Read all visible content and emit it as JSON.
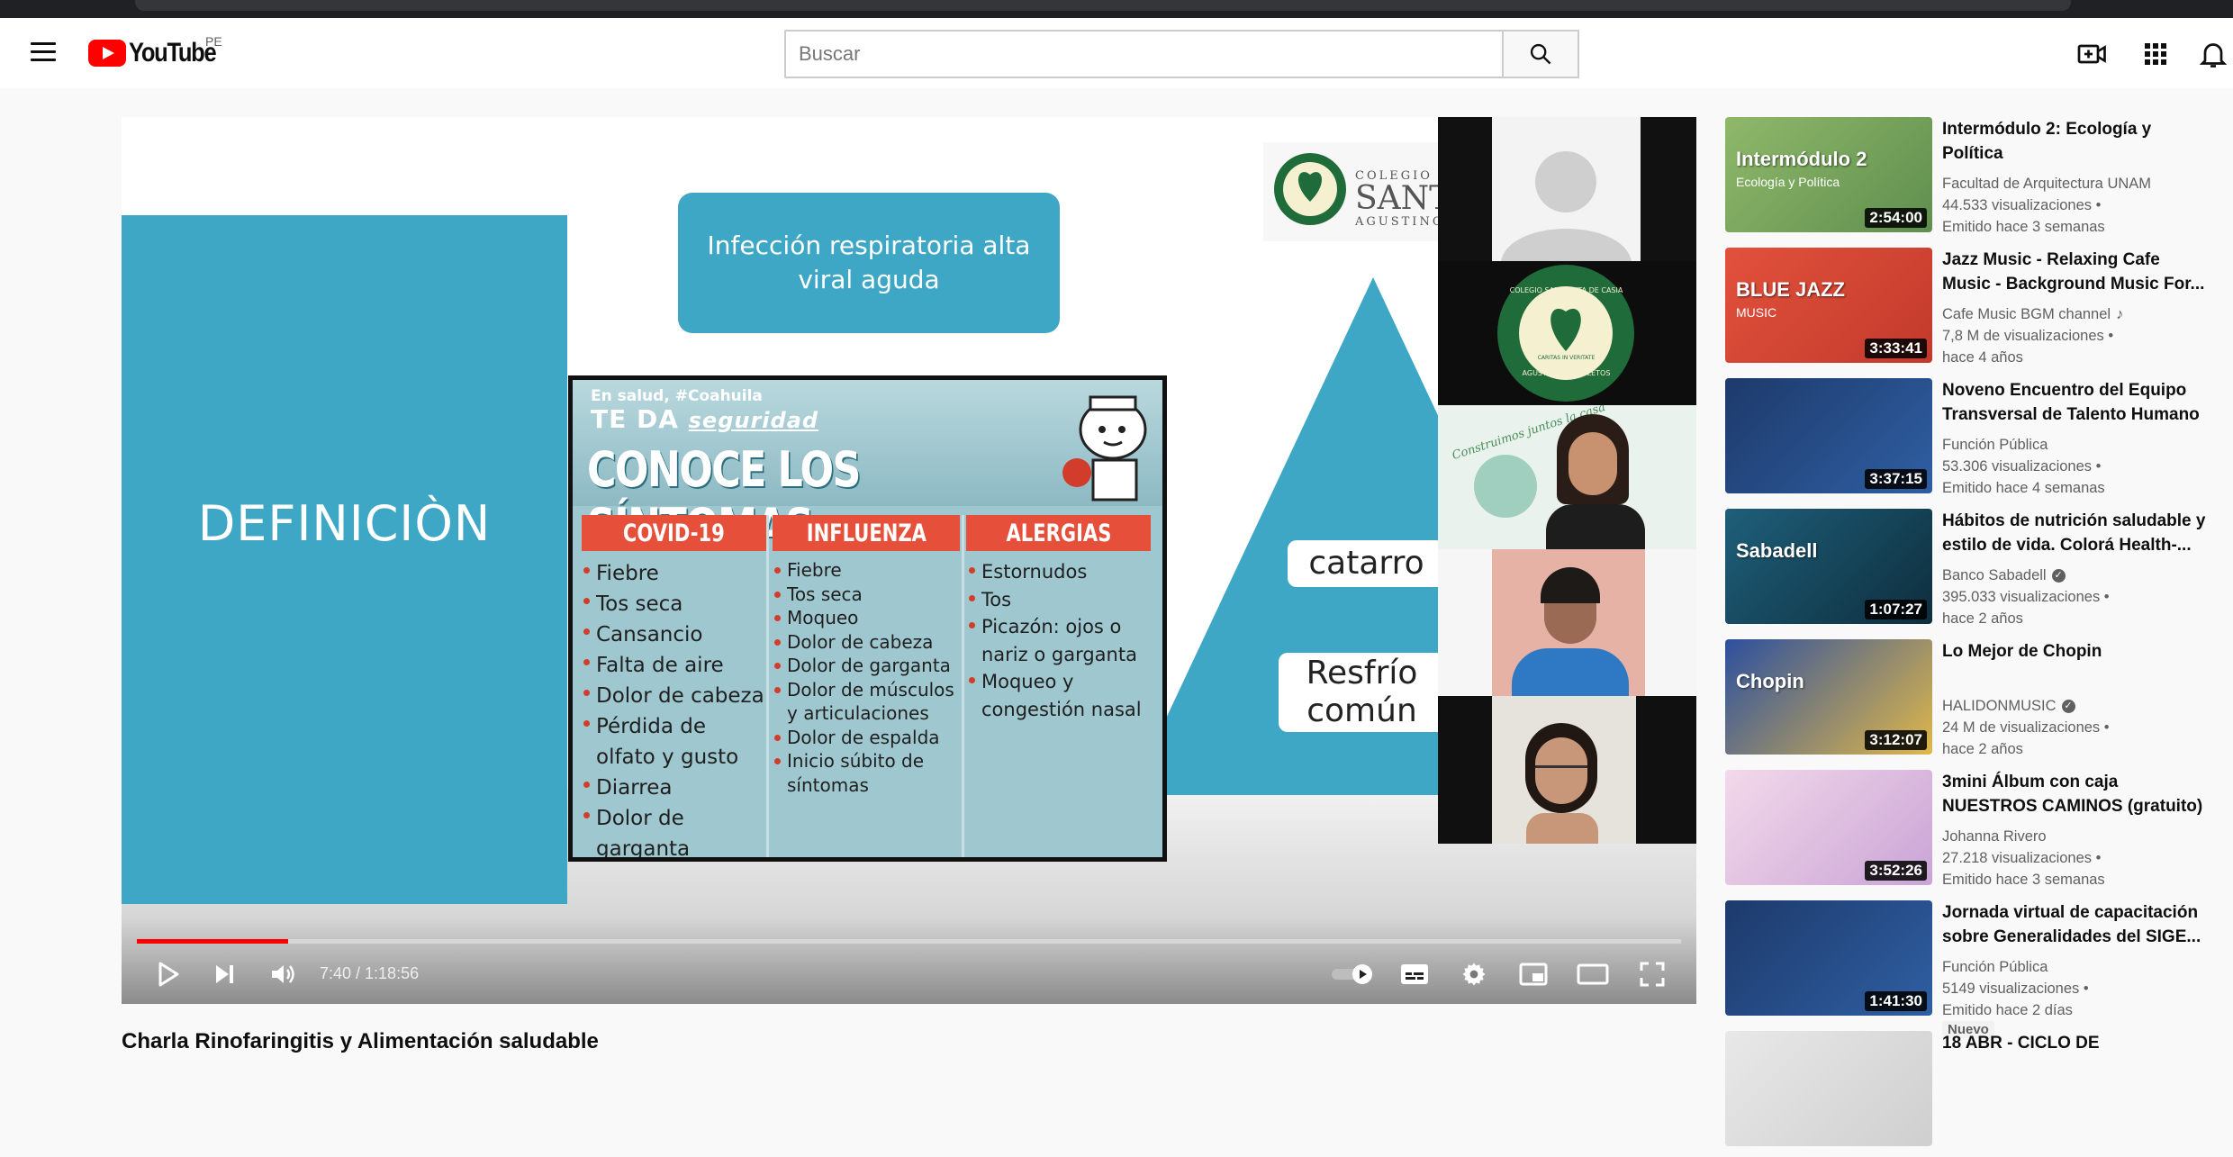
{
  "header": {
    "logo_text": "YouTube",
    "country_code": "PE",
    "search_placeholder": "Buscar"
  },
  "player": {
    "slide": {
      "definition": "DEFINICIÒN",
      "title": "Infección respiratoria alta viral aguda",
      "school_logo_text": [
        "COLEGIO",
        "SANTA",
        "AGUSTINO"
      ],
      "pyramid_labels": [
        "catarro",
        "Resfrío",
        "común"
      ]
    },
    "infographic": {
      "tag_line": "En salud, #Coahuila",
      "tag_main": "TE DA",
      "tag_emph": "seguridad",
      "title": "CONOCE LOS SÍNTOMAS",
      "columns": [
        {
          "header": "COVID-19",
          "items": [
            "Fiebre",
            "Tos seca",
            "Cansancio",
            "Falta de aire",
            "Dolor de cabeza",
            "Pérdida de olfato y gusto",
            "Diarrea",
            "Dolor de garganta"
          ]
        },
        {
          "header": "INFLUENZA",
          "items": [
            "Fiebre",
            "Tos seca",
            "Moqueo",
            "Dolor de cabeza",
            "Dolor de garganta",
            "Dolor de músculos y articulaciones",
            "Dolor de espalda",
            "Inicio súbito de síntomas"
          ]
        },
        {
          "header": "ALERGIAS",
          "items": [
            "Estornudos",
            "Tos",
            "Picazón: ojos o nariz o garganta",
            "Moqueo y congestión nasal"
          ]
        }
      ]
    },
    "tile_logo_text": {
      "top": "COLEGIO SANTA RITA DE CASIA",
      "bottom": "AGUSTINOS RECOLETOS",
      "center": "CARITAS IN VERITATE"
    },
    "tile_caption": "Construimos juntos la casa",
    "progress_fraction": 0.098,
    "time": "7:40 / 1:18:56"
  },
  "video": {
    "title": "Charla Rinofaringitis y Alimentación saludable"
  },
  "recommendations": [
    {
      "title": "Intermódulo 2: Ecología y Política",
      "channel": "Facultad de Arquitectura UNAM",
      "views": "44.533 visualizaciones",
      "age": "Emitido hace 3 semanas",
      "duration": "2:54:00",
      "thumb_text": "Intermódulo 2",
      "thumb_sub": "Ecología y Política",
      "thumb_colors": [
        "#8fb86a",
        "#5f8f4e"
      ]
    },
    {
      "title": "Jazz Music - Relaxing Cafe Music - Background Music For...",
      "channel": "Cafe Music BGM channel",
      "views": "7,8 M de visualizaciones",
      "age": "hace 4 años",
      "duration": "3:33:41",
      "thumb_text": "BLUE JAZZ",
      "thumb_sub": "MUSIC",
      "thumb_colors": [
        "#e2513c",
        "#c23a2b"
      ],
      "channel_icon": "music-note-icon"
    },
    {
      "title": "Noveno Encuentro del Equipo Transversal de Talento Humano",
      "channel": "Función Pública",
      "views": "53.306 visualizaciones",
      "age": "Emitido hace 4 semanas",
      "duration": "3:37:15",
      "thumb_text": "",
      "thumb_sub": "",
      "thumb_colors": [
        "#1d3a6b",
        "#2f5fa3"
      ]
    },
    {
      "title": "Hábitos de nutrición saludable y estilo de vida. Colorá Health-...",
      "channel": "Banco Sabadell",
      "views": "395.033 visualizaciones",
      "age": "hace 2 años",
      "duration": "1:07:27",
      "thumb_text": "Sabadell",
      "thumb_sub": "",
      "thumb_colors": [
        "#1e5f7a",
        "#0e2e3d"
      ],
      "verified": true
    },
    {
      "title": "Lo Mejor de Chopin",
      "channel": "HALIDONMUSIC",
      "views": "24 M de visualizaciones",
      "age": "hace 2 años",
      "duration": "3:12:07",
      "thumb_text": "Chopin",
      "thumb_sub": "",
      "thumb_colors": [
        "#2c4f9e",
        "#e0b84a"
      ],
      "verified": true
    },
    {
      "title": "3mini Álbum con caja NUESTROS CAMINOS (gratuito)",
      "channel": "Johanna Rivero",
      "views": "27.218 visualizaciones",
      "age": "Emitido hace 3 semanas",
      "duration": "3:52:26",
      "thumb_text": "",
      "thumb_sub": "",
      "thumb_colors": [
        "#f3d9ea",
        "#c9a4d6"
      ]
    },
    {
      "title": "Jornada virtual de capacitación sobre Generalidades del SIGE...",
      "channel": "Función Pública",
      "views": "5149 visualizaciones",
      "age": "Emitido hace 2 días",
      "duration": "1:41:30",
      "thumb_text": "",
      "thumb_sub": "",
      "thumb_colors": [
        "#1d3a6b",
        "#2f5fa3"
      ],
      "badge": "Nuevo"
    },
    {
      "title": "18 ABR - CICLO DE",
      "channel": "",
      "views": "",
      "age": "",
      "duration": "",
      "thumb_text": "",
      "thumb_sub": "",
      "thumb_colors": [
        "#e8e8e8",
        "#cfcfcf"
      ]
    }
  ],
  "colors": {
    "accent": "#ff0000",
    "slide_teal": "#3fa7c6",
    "info_red": "#e6503a"
  }
}
